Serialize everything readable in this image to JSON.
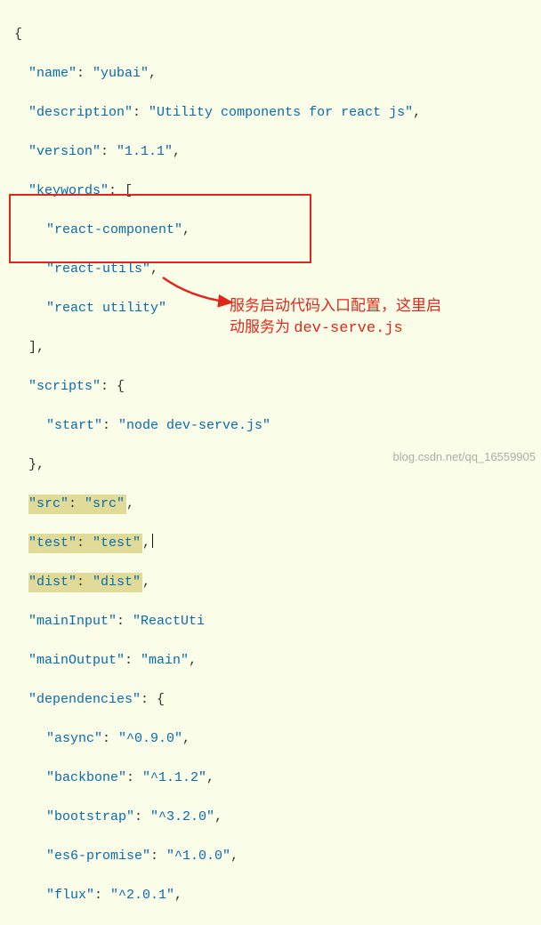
{
  "code": {
    "open_brace": "{",
    "name_key": "\"name\"",
    "name_val": "\"yubai\"",
    "desc_key": "\"description\"",
    "desc_val": "\"Utility components for react js\"",
    "ver_key": "\"version\"",
    "ver_val": "\"1.1.1\"",
    "kw_key": "\"keywords\"",
    "kw_open": "[",
    "kw0": "\"react-component\"",
    "kw1": "\"react-utils\"",
    "kw2": "\"react utility\"",
    "kw_close": "],",
    "scripts_key": "\"scripts\"",
    "scripts_open": "{",
    "start_key": "\"start\"",
    "start_val": "\"node dev-serve.js\"",
    "scripts_close": "},",
    "src_key": "\"src\"",
    "src_val": "\"src\"",
    "test_key": "\"test\"",
    "test_val": "\"test\"",
    "dist_key": "\"dist\"",
    "dist_val": "\"dist\"",
    "mainIn_key": "\"mainInput\"",
    "mainIn_val": "\"ReactUti",
    "mainOut_key": "\"mainOutput\"",
    "mainOut_val": "\"main\"",
    "deps_key": "\"dependencies\"",
    "deps_open": "{",
    "async_key": "\"async\"",
    "async_val": "\"^0.9.0\"",
    "backbone_key": "\"backbone\"",
    "backbone_val": "\"^1.1.2\"",
    "bootstrap_key": "\"bootstrap\"",
    "bootstrap_val": "\"^3.2.0\"",
    "es6_key": "\"es6-promise\"",
    "es6_val": "\"^1.0.0\"",
    "flux_key": "\"flux\"",
    "flux_val": "\"^2.0.1\""
  },
  "annotation": {
    "line1": "服务启动代码入口配置，这里启",
    "line2a": "动服务为  ",
    "line2b": "dev-serve.js"
  },
  "watermark": "blog.csdn.net/qq_16559905"
}
